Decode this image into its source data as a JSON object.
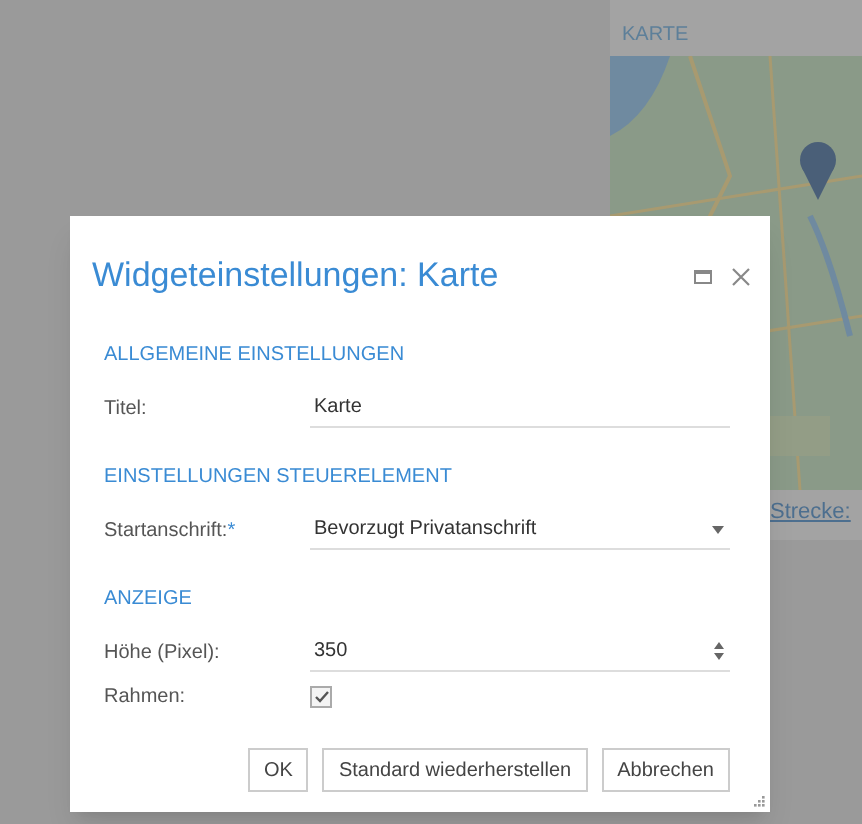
{
  "background": {
    "map_widget": {
      "title": "KARTE",
      "kind": "picture",
      "link": "Strecke:"
    }
  },
  "dialog": {
    "title": "Widgeteinstellungen: Karte",
    "sections": [
      {
        "heading": "ALLGEMEINE EINSTELLUNGEN",
        "fields": [
          {
            "kind": "text",
            "label": "Titel:",
            "value": "Karte"
          }
        ]
      },
      {
        "heading": "EINSTELLUNGEN STEUERELEMENT",
        "fields": [
          {
            "kind": "select",
            "label": "Startanschrift:",
            "required_mark": "*",
            "value": "Bevorzugt Privatanschrift"
          }
        ]
      },
      {
        "heading": "ANZEIGE",
        "fields": [
          {
            "kind": "number",
            "label": "Höhe (Pixel):",
            "value": "350"
          },
          {
            "kind": "checkbox",
            "label": "Rahmen:",
            "checked": true
          }
        ]
      }
    ],
    "buttons": [
      "OK",
      "Standard wiederherstellen",
      "Abbrechen"
    ]
  }
}
